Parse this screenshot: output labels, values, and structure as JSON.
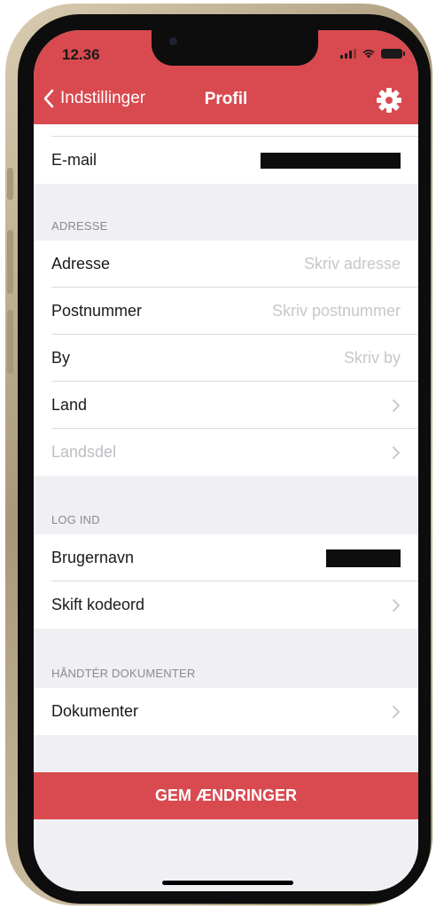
{
  "status_bar": {
    "time": "12.36"
  },
  "nav": {
    "back_label": "Indstillinger",
    "title": "Profil"
  },
  "contact": {
    "email_label": "E-mail"
  },
  "address_section": {
    "header": "ADRESSE",
    "address_label": "Adresse",
    "address_placeholder": "Skriv adresse",
    "postal_label": "Postnummer",
    "postal_placeholder": "Skriv postnummer",
    "city_label": "By",
    "city_placeholder": "Skriv by",
    "country_label": "Land",
    "region_label": "Landsdel"
  },
  "login_section": {
    "header": "LOG IND",
    "username_label": "Brugernavn",
    "change_password_label": "Skift kodeord"
  },
  "documents_section": {
    "header": "HÅNDTÉR DOKUMENTER",
    "documents_label": "Dokumenter"
  },
  "save_button": {
    "label": "GEM ÆNDRINGER"
  },
  "colors": {
    "accent": "#d84a50",
    "background": "#efeff4",
    "placeholder": "#c7c7cc"
  },
  "icons": {
    "back": "chevron-left-icon",
    "settings": "gear-icon",
    "disclosure": "chevron-right-icon"
  }
}
